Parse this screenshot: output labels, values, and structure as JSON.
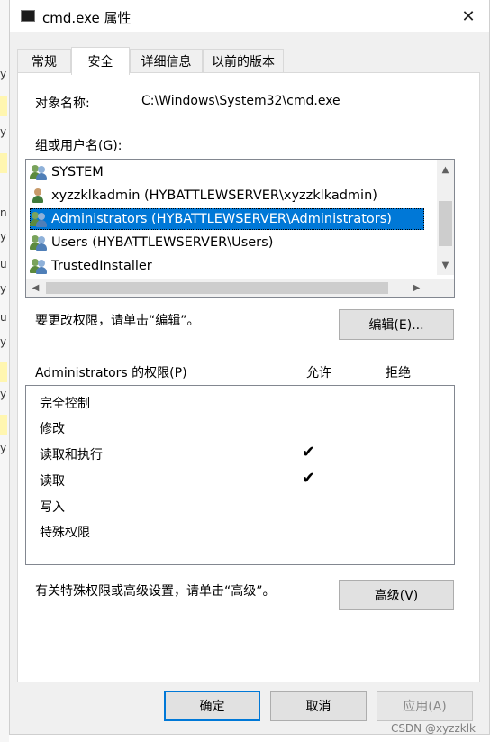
{
  "window": {
    "title": "cmd.exe 属性",
    "close_glyph": "✕"
  },
  "tabs": [
    {
      "label": "常规"
    },
    {
      "label": "安全"
    },
    {
      "label": "详细信息"
    },
    {
      "label": "以前的版本"
    }
  ],
  "active_tab": "安全",
  "object": {
    "label": "对象名称:",
    "value": "C:\\Windows\\System32\\cmd.exe"
  },
  "groups": {
    "label": "组或用户名(G):",
    "items": [
      {
        "name": "SYSTEM",
        "icon": "group-users-icon",
        "selected": false
      },
      {
        "name": "xyzzklkadmin (HYBATTLEWSERVER\\xyzzklkadmin)",
        "icon": "user-icon",
        "selected": false
      },
      {
        "name": "Administrators (HYBATTLEWSERVER\\Administrators)",
        "icon": "group-users-icon",
        "selected": true
      },
      {
        "name": "Users (HYBATTLEWSERVER\\Users)",
        "icon": "group-users-icon",
        "selected": false
      },
      {
        "name": "TrustedInstaller",
        "icon": "group-users-icon",
        "selected": false
      }
    ],
    "scroll_up": "▲",
    "scroll_down": "▼",
    "scroll_left": "◀",
    "scroll_right": "▶"
  },
  "edit": {
    "hint": "要更改权限，请单击“编辑”。",
    "button": "编辑(E)..."
  },
  "permissions": {
    "title": "Administrators 的权限(P)",
    "allow_header": "允许",
    "deny_header": "拒绝",
    "check_glyph": "✔",
    "rows": [
      {
        "label": "完全控制",
        "allow": false,
        "deny": false
      },
      {
        "label": "修改",
        "allow": false,
        "deny": false
      },
      {
        "label": "读取和执行",
        "allow": true,
        "deny": false
      },
      {
        "label": "读取",
        "allow": true,
        "deny": false
      },
      {
        "label": "写入",
        "allow": false,
        "deny": false
      },
      {
        "label": "特殊权限",
        "allow": false,
        "deny": false
      }
    ]
  },
  "advanced": {
    "hint": "有关特殊权限或高级设置，请单击“高级”。",
    "button": "高级(V)"
  },
  "footer": {
    "ok": "确定",
    "cancel": "取消",
    "apply": "应用(A)"
  },
  "watermark": "CSDN @xyzzklk",
  "background_strip": [
    "y",
    "y",
    "n",
    "y",
    "n",
    "y",
    "u",
    "y",
    "u",
    "y",
    "y",
    "y",
    "y"
  ]
}
